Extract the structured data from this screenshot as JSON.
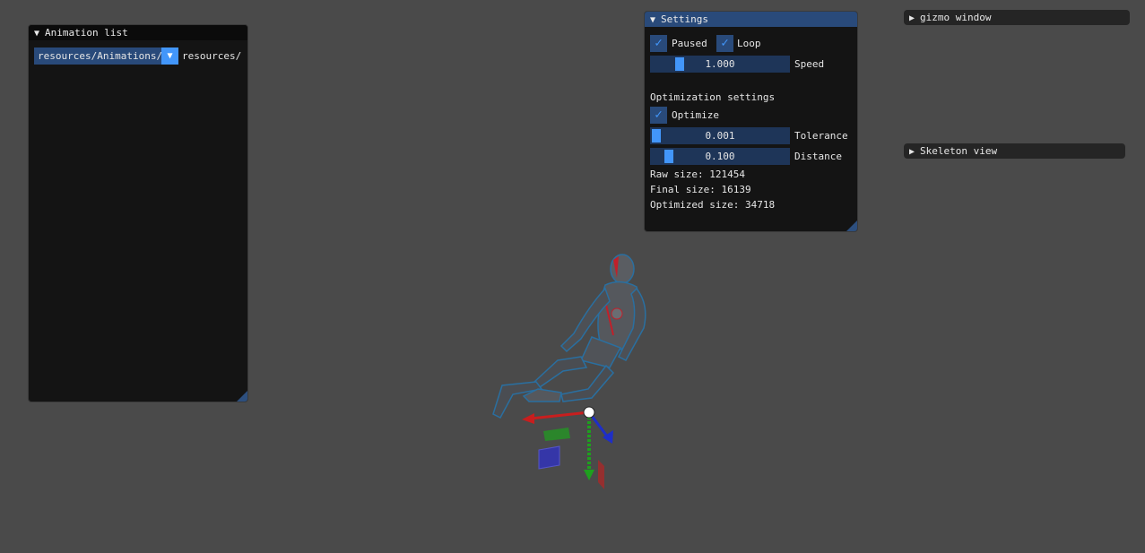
{
  "animation_list": {
    "title": "Animation list",
    "combo_value": "resources/Animations/",
    "combo_label": "resources/"
  },
  "settings": {
    "title": "Settings",
    "paused_label": "Paused",
    "paused_checked": true,
    "loop_label": "Loop",
    "loop_checked": true,
    "speed_value": "1.000",
    "speed_label": "Speed",
    "optimization_heading": "Optimization settings",
    "optimize_label": "Optimize",
    "optimize_checked": true,
    "tolerance_value": "0.001",
    "tolerance_label": "Tolerance",
    "distance_value": "0.100",
    "distance_label": "Distance",
    "raw_size": "Raw size: 121454",
    "final_size": "Final size: 16139",
    "optimized_size": "Optimized size: 34718"
  },
  "gizmo_window": {
    "title": "gizmo window"
  },
  "skeleton_view": {
    "title": "Skeleton view"
  },
  "icons": {
    "collapse": "triangle-down",
    "expand": "triangle-right",
    "check": "checkmark"
  },
  "colors": {
    "background": "#4a4a4a",
    "window_bg": "#141414",
    "title_active": "#294a7a",
    "accent": "#4296fa",
    "frame": "#294a7a",
    "gizmo_x": "#c81e1e",
    "gizmo_y": "#1ea01e",
    "gizmo_z": "#1e2ec8"
  }
}
